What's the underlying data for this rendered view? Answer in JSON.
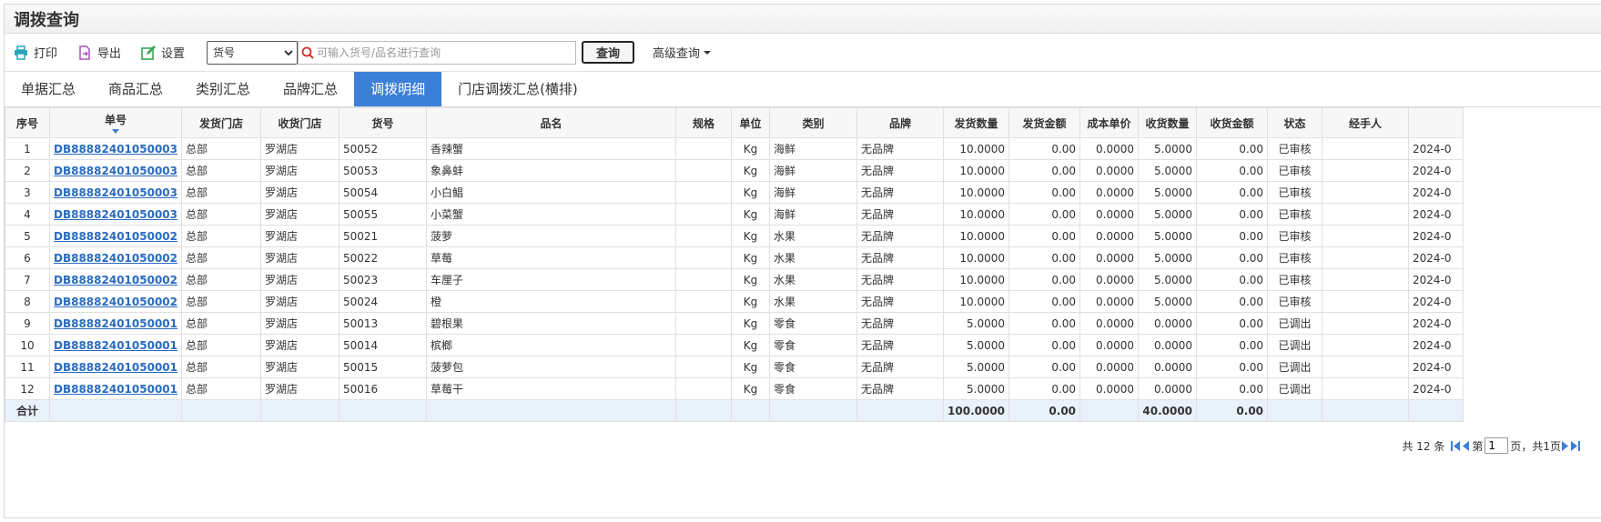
{
  "page": {
    "title": "调拨查询"
  },
  "toolbar": {
    "print": "打印",
    "export": "导出",
    "settings": "设置",
    "field_select": "货号",
    "search_placeholder": "可输入货号/品名进行查询",
    "query": "查询",
    "advanced": "高级查询"
  },
  "tabs": [
    {
      "label": "单据汇总"
    },
    {
      "label": "商品汇总"
    },
    {
      "label": "类别汇总"
    },
    {
      "label": "品牌汇总"
    },
    {
      "label": "调拨明细",
      "active": true
    },
    {
      "label": "门店调拨汇总(横排)"
    }
  ],
  "table": {
    "columns": [
      "序号",
      "单号",
      "发货门店",
      "收货门店",
      "货号",
      "品名",
      "规格",
      "单位",
      "类别",
      "品牌",
      "发货数量",
      "发货金额",
      "成本单价",
      "收货数量",
      "收货金额",
      "状态",
      "经手人",
      ""
    ],
    "rows": [
      [
        "1",
        "DB88882401050003",
        "总部",
        "罗湖店",
        "50052",
        "香辣蟹",
        "",
        "Kg",
        "海鲜",
        "无品牌",
        "10.0000",
        "0.00",
        "0.0000",
        "5.0000",
        "0.00",
        "已审核",
        "",
        "2024-0"
      ],
      [
        "2",
        "DB88882401050003",
        "总部",
        "罗湖店",
        "50053",
        "象鼻蚌",
        "",
        "Kg",
        "海鲜",
        "无品牌",
        "10.0000",
        "0.00",
        "0.0000",
        "5.0000",
        "0.00",
        "已审核",
        "",
        "2024-0"
      ],
      [
        "3",
        "DB88882401050003",
        "总部",
        "罗湖店",
        "50054",
        "小白鲳",
        "",
        "Kg",
        "海鲜",
        "无品牌",
        "10.0000",
        "0.00",
        "0.0000",
        "5.0000",
        "0.00",
        "已审核",
        "",
        "2024-0"
      ],
      [
        "4",
        "DB88882401050003",
        "总部",
        "罗湖店",
        "50055",
        "小菜蟹",
        "",
        "Kg",
        "海鲜",
        "无品牌",
        "10.0000",
        "0.00",
        "0.0000",
        "5.0000",
        "0.00",
        "已审核",
        "",
        "2024-0"
      ],
      [
        "5",
        "DB88882401050002",
        "总部",
        "罗湖店",
        "50021",
        "菠萝",
        "",
        "Kg",
        "水果",
        "无品牌",
        "10.0000",
        "0.00",
        "0.0000",
        "5.0000",
        "0.00",
        "已审核",
        "",
        "2024-0"
      ],
      [
        "6",
        "DB88882401050002",
        "总部",
        "罗湖店",
        "50022",
        "草莓",
        "",
        "Kg",
        "水果",
        "无品牌",
        "10.0000",
        "0.00",
        "0.0000",
        "5.0000",
        "0.00",
        "已审核",
        "",
        "2024-0"
      ],
      [
        "7",
        "DB88882401050002",
        "总部",
        "罗湖店",
        "50023",
        "车厘子",
        "",
        "Kg",
        "水果",
        "无品牌",
        "10.0000",
        "0.00",
        "0.0000",
        "5.0000",
        "0.00",
        "已审核",
        "",
        "2024-0"
      ],
      [
        "8",
        "DB88882401050002",
        "总部",
        "罗湖店",
        "50024",
        "橙",
        "",
        "Kg",
        "水果",
        "无品牌",
        "10.0000",
        "0.00",
        "0.0000",
        "5.0000",
        "0.00",
        "已审核",
        "",
        "2024-0"
      ],
      [
        "9",
        "DB88882401050001",
        "总部",
        "罗湖店",
        "50013",
        "碧根果",
        "",
        "Kg",
        "零食",
        "无品牌",
        "5.0000",
        "0.00",
        "0.0000",
        "0.0000",
        "0.00",
        "已调出",
        "",
        "2024-0"
      ],
      [
        "10",
        "DB88882401050001",
        "总部",
        "罗湖店",
        "50014",
        "槟榔",
        "",
        "Kg",
        "零食",
        "无品牌",
        "5.0000",
        "0.00",
        "0.0000",
        "0.0000",
        "0.00",
        "已调出",
        "",
        "2024-0"
      ],
      [
        "11",
        "DB88882401050001",
        "总部",
        "罗湖店",
        "50015",
        "菠萝包",
        "",
        "Kg",
        "零食",
        "无品牌",
        "5.0000",
        "0.00",
        "0.0000",
        "0.0000",
        "0.00",
        "已调出",
        "",
        "2024-0"
      ],
      [
        "12",
        "DB88882401050001",
        "总部",
        "罗湖店",
        "50016",
        "草莓干",
        "",
        "Kg",
        "零食",
        "无品牌",
        "5.0000",
        "0.00",
        "0.0000",
        "0.0000",
        "0.00",
        "已调出",
        "",
        "2024-0"
      ]
    ],
    "total_label": "合计",
    "totals": {
      "send_qty": "100.0000",
      "send_amount": "0.00",
      "recv_qty": "40.0000",
      "recv_amount": "0.00"
    }
  },
  "pager": {
    "count_text": "共 12 条",
    "page_prefix": "第",
    "page_value": "1",
    "page_suffix": "页，共1页"
  },
  "colors": {
    "accent": "#3c7fd8",
    "link": "#2a6bbf",
    "total_bg": "#e9f1fb"
  }
}
